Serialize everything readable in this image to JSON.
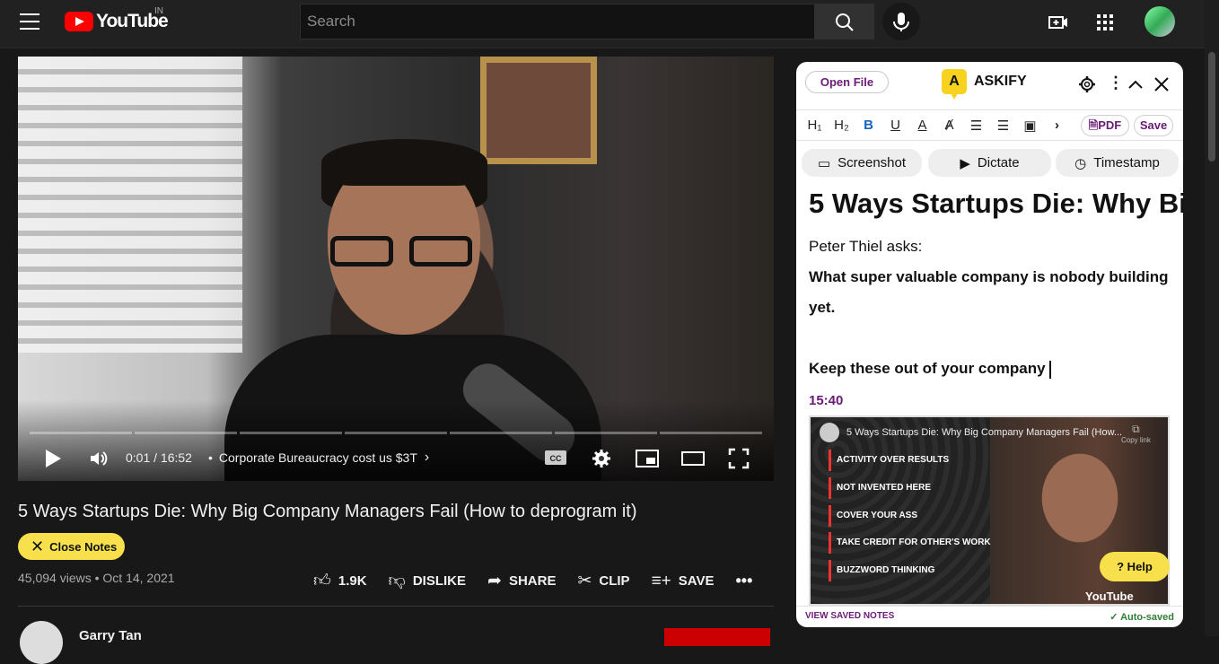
{
  "header": {
    "logo_text": "YouTube",
    "country": "IN",
    "search_placeholder": "Search"
  },
  "player": {
    "time": "0:01 / 16:52",
    "chapter": "Corporate Bureaucracy cost us $3T",
    "progress": 0.001
  },
  "video": {
    "title": "5 Ways Startups Die: Why Big Company Managers Fail (How to deprogram it)",
    "close_notes": "Close Notes",
    "views_date": "45,094 views • Oct 14, 2021",
    "actions": {
      "like": "1.9K",
      "dislike": "DISLIKE",
      "share": "SHARE",
      "clip": "CLIP",
      "save": "SAVE"
    },
    "channel": "Garry Tan"
  },
  "askify": {
    "open_file": "Open File",
    "brand": "ASKIFY",
    "brand_letter": "A",
    "pdf": "PDF",
    "save": "Save",
    "buttons": {
      "screenshot": "Screenshot",
      "dictate": "Dictate",
      "timestamp": "Timestamp"
    },
    "note": {
      "heading": "5 Ways Startups Die: Why Bi",
      "p1": "Peter Thiel asks:",
      "p2": "What super valuable company is nobody building",
      "p3": "yet.",
      "p4": "Keep these out of your company",
      "timestamp": "15:40"
    },
    "shot": {
      "title": "5 Ways Startups Die: Why Big Company Managers Fail (How...",
      "copy": "Copy link",
      "items": [
        "ACTIVITY OVER RESULTS",
        "NOT INVENTED HERE",
        "COVER YOUR ASS",
        "TAKE CREDIT FOR OTHER'S WORK",
        "BUZZWORD THINKING"
      ],
      "brand": "YouTube"
    },
    "help": "? Help",
    "view_saved": "VIEW SAVED NOTES",
    "autosaved": "✓ Auto-saved"
  }
}
